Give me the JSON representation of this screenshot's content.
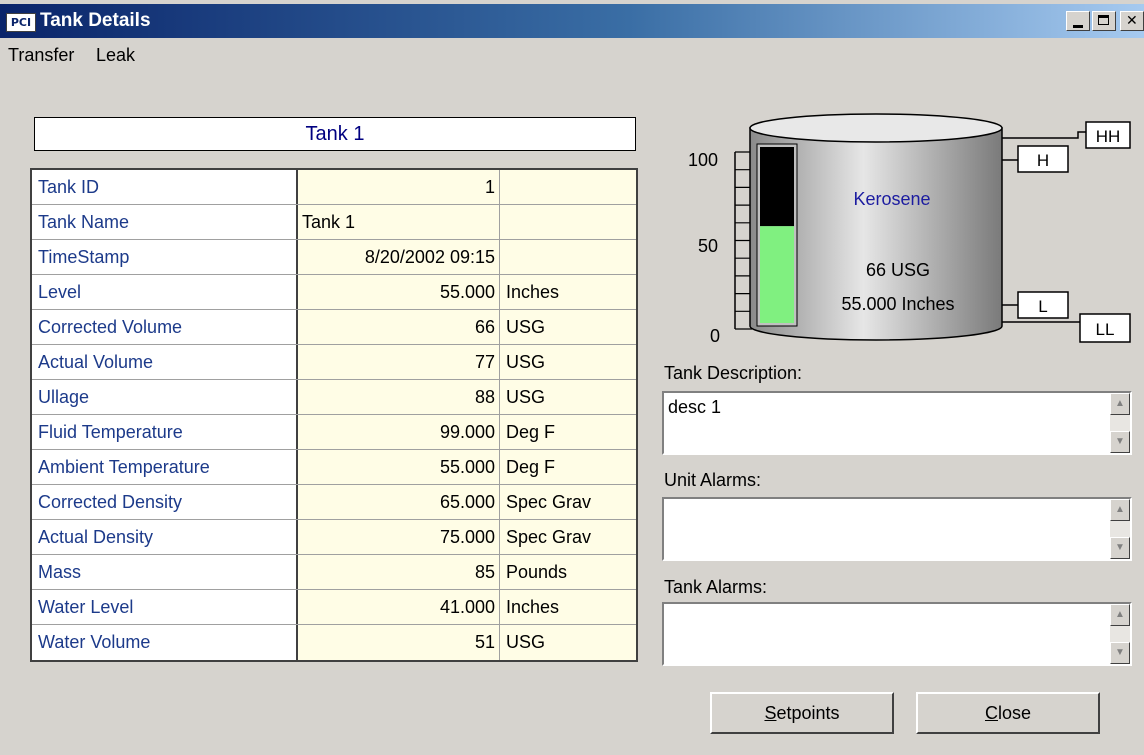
{
  "window": {
    "title": "Tank Details",
    "icon_text": "PCI",
    "controls": [
      "minimize",
      "maximize",
      "close"
    ]
  },
  "menu": [
    "Transfer",
    "Leak"
  ],
  "tank_title": "Tank 1",
  "details": [
    {
      "label": "Tank ID",
      "value": "1",
      "unit": "",
      "align": "right"
    },
    {
      "label": "Tank Name",
      "value": "Tank 1",
      "unit": "",
      "align": "left"
    },
    {
      "label": "TimeStamp",
      "value": "8/20/2002 09:15",
      "unit": "",
      "align": "right"
    },
    {
      "label": "Level",
      "value": "55.000",
      "unit": "Inches",
      "align": "right"
    },
    {
      "label": "Corrected Volume",
      "value": "66",
      "unit": "USG",
      "align": "right"
    },
    {
      "label": "Actual Volume",
      "value": "77",
      "unit": "USG",
      "align": "right"
    },
    {
      "label": "Ullage",
      "value": "88",
      "unit": "USG",
      "align": "right"
    },
    {
      "label": "Fluid Temperature",
      "value": "99.000",
      "unit": "Deg F",
      "align": "right"
    },
    {
      "label": "Ambient Temperature",
      "value": "55.000",
      "unit": "Deg F",
      "align": "right"
    },
    {
      "label": "Corrected Density",
      "value": "65.000",
      "unit": "Spec Grav",
      "align": "right"
    },
    {
      "label": "Actual Density",
      "value": "75.000",
      "unit": "Spec Grav",
      "align": "right"
    },
    {
      "label": "Mass",
      "value": "85",
      "unit": "Pounds",
      "align": "right"
    },
    {
      "label": "Water Level",
      "value": "41.000",
      "unit": "Inches",
      "align": "right"
    },
    {
      "label": "Water Volume",
      "value": "51",
      "unit": "USG",
      "align": "right"
    }
  ],
  "tank_graphic": {
    "product": "Kerosene",
    "volume_text": "66 USG",
    "level_text": "55.000 Inches",
    "scale_labels": [
      "100",
      "50",
      "0"
    ],
    "fill_percent": 55,
    "alarms": [
      "HH",
      "H",
      "L",
      "LL"
    ],
    "colors": {
      "fill": "#80f080",
      "empty": "#000000",
      "product_text": "#1c1ca0"
    }
  },
  "tank_description": {
    "label": "Tank Description:",
    "value": "desc 1"
  },
  "unit_alarms": {
    "label": "Unit Alarms:",
    "value": ""
  },
  "tank_alarms": {
    "label": "Tank Alarms:",
    "value": ""
  },
  "buttons": {
    "setpoints": {
      "mnemonic": "S",
      "rest": "etpoints"
    },
    "close": {
      "mnemonic": "C",
      "rest": "lose"
    }
  }
}
